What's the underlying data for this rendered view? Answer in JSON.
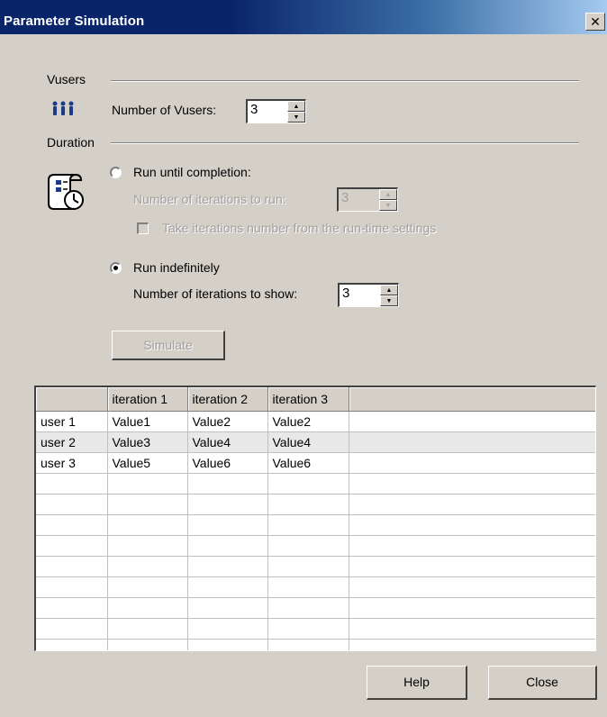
{
  "window": {
    "title": "Parameter Simulation",
    "close_glyph": "✕"
  },
  "vusers": {
    "section_label": "Vusers",
    "icon": "users-icon",
    "count_label": "Number of Vusers:",
    "count_value": "3"
  },
  "duration": {
    "section_label": "Duration",
    "icon": "script-clock-icon",
    "run_until_completion": {
      "label": "Run until completion:",
      "selected": false,
      "iterations_label": "Number of iterations to run:",
      "iterations_value": "3",
      "checkbox_label": "Take iterations number from the run-time settings",
      "checkbox_checked": false
    },
    "run_indefinitely": {
      "label": "Run indefinitely",
      "selected": true,
      "show_label": "Number of iterations to show:",
      "show_value": "3"
    }
  },
  "simulate_label": "Simulate",
  "grid": {
    "columns": [
      "",
      "iteration 1",
      "iteration 2",
      "iteration 3",
      ""
    ],
    "rows": [
      [
        "user 1",
        "Value1",
        "Value2",
        "Value2",
        ""
      ],
      [
        "user 2",
        "Value3",
        "Value4",
        "Value4",
        ""
      ],
      [
        "user 3",
        "Value5",
        "Value6",
        "Value6",
        ""
      ]
    ],
    "highlighted_row": 1
  },
  "footer": {
    "help_label": "Help",
    "close_label": "Close"
  },
  "colors": {
    "title_bar": "#0a246a",
    "face": "#d4d0c8",
    "icon_blue": "#1a3a8a"
  }
}
